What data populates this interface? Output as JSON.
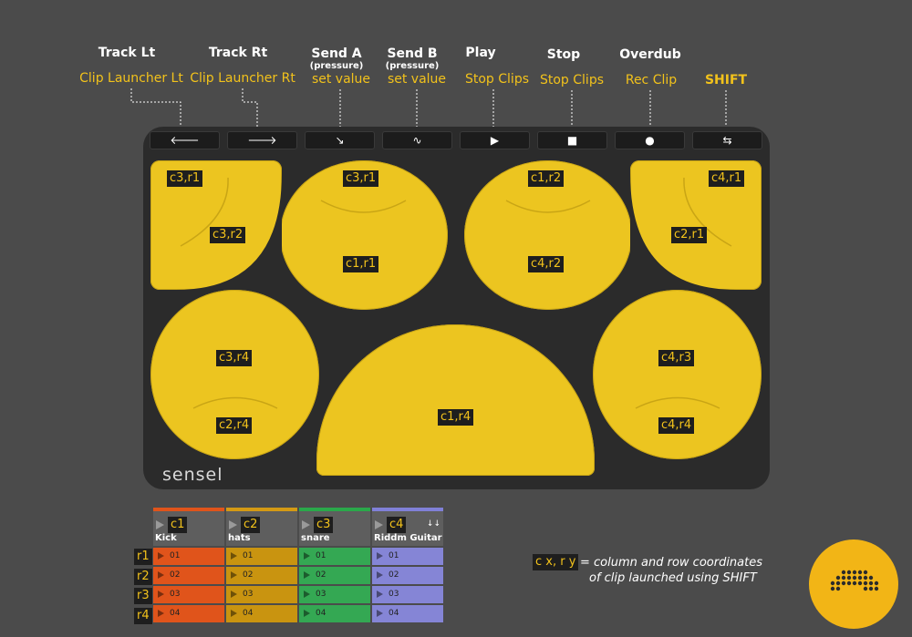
{
  "columns": [
    {
      "header": "Track Lt",
      "shift": "Clip Launcher Lt",
      "button_icon": "arrow-left-icon",
      "glyph": "🡐"
    },
    {
      "header": "Track Rt",
      "shift": "Clip Launcher Rt",
      "button_icon": "arrow-right-icon",
      "glyph": "🡒"
    },
    {
      "header": "Send A",
      "sub": "(pressure)",
      "shift": "set value",
      "button_icon": "send-a-icon",
      "glyph": "↘"
    },
    {
      "header": "Send B",
      "sub": "(pressure)",
      "shift": "set value",
      "button_icon": "send-b-icon",
      "glyph": "∿"
    },
    {
      "header": "Play",
      "shift": "Stop Clips",
      "button_icon": "play-icon",
      "glyph": "▶"
    },
    {
      "header": "Stop",
      "shift": "Stop Clips",
      "button_icon": "stop-icon",
      "glyph": "■"
    },
    {
      "header": "Overdub",
      "shift": "Rec Clip",
      "button_icon": "record-icon",
      "glyph": "●"
    },
    {
      "header": "",
      "shift": "SHIFT",
      "button_icon": "loop-icon",
      "glyph": "⇆"
    }
  ],
  "pads": {
    "tl_a": "c3,r1",
    "tl_b": "c3,r2",
    "c2_top": "c3,r1",
    "c2_mid": "c1,r1",
    "c3_top": "c1,r2",
    "c3_mid": "c4,r2",
    "tr_a": "c4,r1",
    "tr_b": "c2,r1",
    "bl_top": "c3,r4",
    "bl_bot": "c2,r4",
    "mid": "c1,r4",
    "br_top": "c4,r3",
    "br_bot": "c4,r4"
  },
  "brand": "sensel",
  "clip_grid": {
    "tracks": [
      {
        "tag": "c1",
        "name": "Kick",
        "color": "#e0541b",
        "cell_color": "#e0541b"
      },
      {
        "tag": "c2",
        "name": "hats",
        "color": "#d49a14",
        "cell_color": "#c99410"
      },
      {
        "tag": "c3",
        "name": "snare",
        "color": "#2aa84a",
        "cell_color": "#34a853"
      },
      {
        "tag": "c4",
        "name": "Riddm Guitar",
        "color": "#8080d8",
        "cell_color": "#8585d6",
        "arrows": "↓↓"
      }
    ],
    "rows": [
      "r1",
      "r2",
      "r3",
      "r4"
    ],
    "clips": [
      "01",
      "02",
      "03",
      "04"
    ]
  },
  "legend": {
    "tag": "c x, r y",
    "text1": "= column and row coordinates",
    "text2": "of clip launched using SHIFT"
  },
  "colors": {
    "pad": "#ecc520",
    "accent": "#f2c21b",
    "background": "#4b4b4b"
  }
}
